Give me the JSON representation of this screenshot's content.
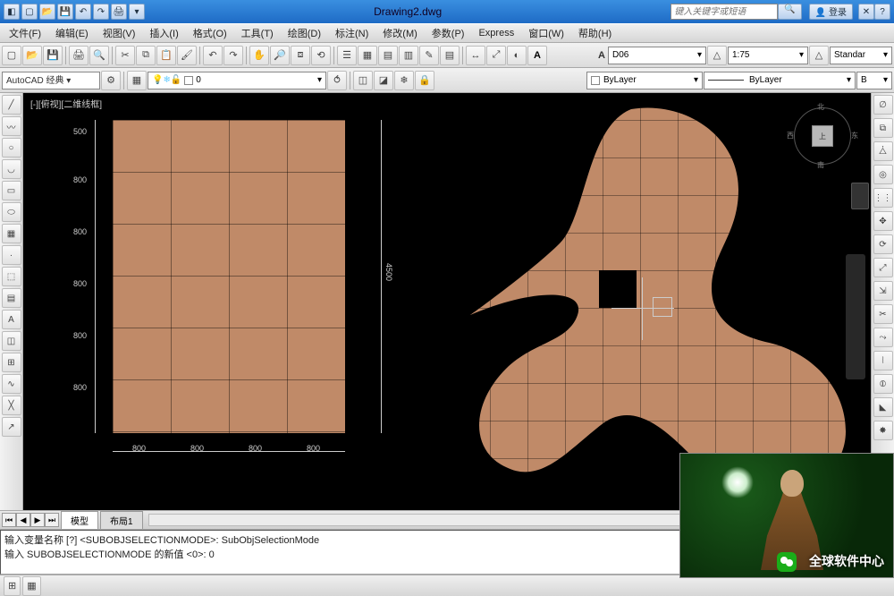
{
  "title": {
    "filename": "Drawing2.dwg",
    "search_placeholder": "键入关键字或短语",
    "login_label": "登录"
  },
  "menus": [
    "文件(F)",
    "编辑(E)",
    "视图(V)",
    "插入(I)",
    "格式(O)",
    "工具(T)",
    "绘图(D)",
    "标注(N)",
    "修改(M)",
    "参数(P)",
    "Express",
    "窗口(W)",
    "帮助(H)"
  ],
  "toolbar1": {
    "style_combo": "D06",
    "scale_combo": "1:75",
    "std_combo": "Standar"
  },
  "toolbar2": {
    "workspace_combo": "AutoCAD 经典",
    "layer_state": "0",
    "bylayer1": "ByLayer",
    "bylayer2": "ByLayer",
    "bylayer3": "B"
  },
  "viewport_label": "[-][俯视][二维线框]",
  "viewcube": {
    "top": "北",
    "bottom": "南",
    "left": "西",
    "right": "东",
    "face": "上"
  },
  "dims": {
    "v_labels": [
      "500",
      "800",
      "800",
      "800",
      "800",
      "800"
    ],
    "h_labels": [
      "800",
      "800",
      "800",
      "800"
    ],
    "overall_v": "4500"
  },
  "tabs": {
    "model": "模型",
    "layout1": "布局1"
  },
  "command": {
    "line1": "输入变量名称 [?] <SUBOBJSELECTIONMODE>: SubObjSelectionMode",
    "line2": "输入 SUBOBJSELECTIONMODE 的新值 <0>: 0"
  },
  "overlay": {
    "watermark": "全球软件中心"
  }
}
